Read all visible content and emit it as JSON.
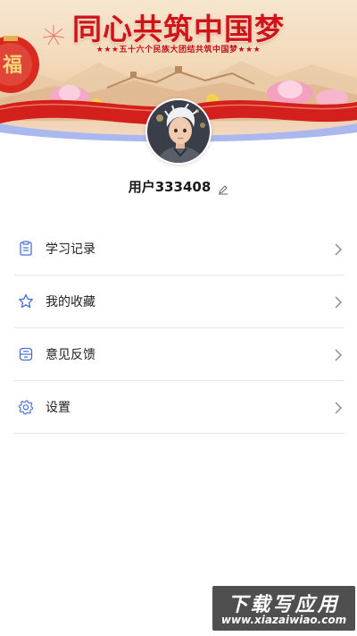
{
  "banner": {
    "title": "同心共筑中国梦",
    "subtitle": "★★★五十六个民族大团结共筑中国梦★★★"
  },
  "profile": {
    "username": "用户333408",
    "avatar_icon": "avatar-boy-illustration",
    "edit_icon": "pencil-icon"
  },
  "menu": {
    "items": [
      {
        "label": "学习记录",
        "icon": "clipboard-icon"
      },
      {
        "label": "我的收藏",
        "icon": "star-icon"
      },
      {
        "label": "意见反馈",
        "icon": "feedback-box-icon"
      },
      {
        "label": "设置",
        "icon": "gear-icon"
      }
    ]
  },
  "watermark": {
    "title": "下载写应用",
    "url": "www.xiazaiwiao.com"
  },
  "colors": {
    "accent_blue": "#4a6fd6",
    "banner_red": "#d0131b",
    "curve_blue": "#aab8ef",
    "divider": "#e4e4e4"
  }
}
